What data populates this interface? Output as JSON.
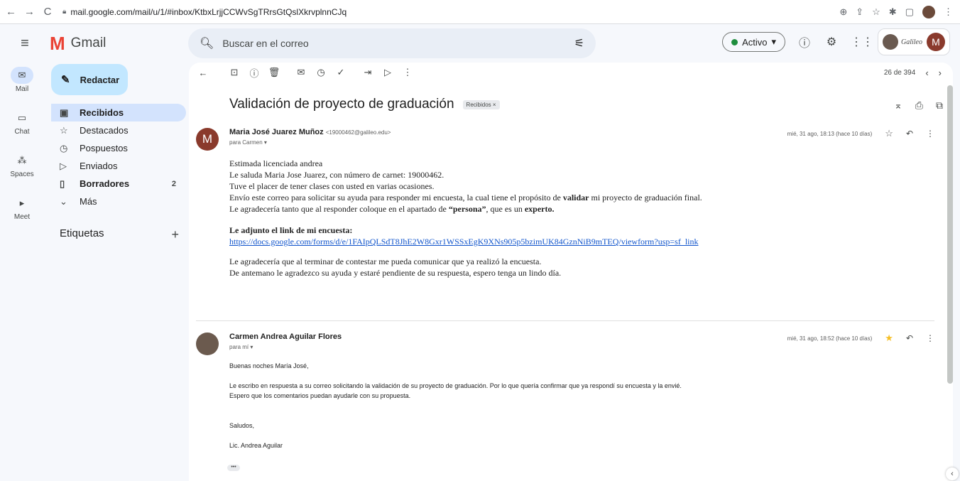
{
  "browser": {
    "url": "mail.google.com/mail/u/1/#inbox/KtbxLrjjCCWvSgTRrsGtQslXkrvplnnCJq",
    "back_icon": "←",
    "forward_icon": "→",
    "reload_icon": "C"
  },
  "header": {
    "app_name": "Gmail",
    "search_placeholder": "Buscar en el correo",
    "status_label": "Activo",
    "org_name": "Galileo",
    "avatar_letter": "M"
  },
  "rail": [
    {
      "label": "Mail",
      "icon": "mail-icon",
      "glyph": "✉"
    },
    {
      "label": "Chat",
      "icon": "chat-icon",
      "glyph": "▭"
    },
    {
      "label": "Spaces",
      "icon": "spaces-icon",
      "glyph": "⁂"
    },
    {
      "label": "Meet",
      "icon": "meet-icon",
      "glyph": "▸"
    }
  ],
  "compose_label": "Redactar",
  "nav": [
    {
      "label": "Recibidos",
      "icon": "inbox-icon",
      "glyph": "▣",
      "count": ""
    },
    {
      "label": "Destacados",
      "icon": "star-icon",
      "glyph": "☆",
      "count": ""
    },
    {
      "label": "Pospuestos",
      "icon": "clock-icon",
      "glyph": "◷",
      "count": ""
    },
    {
      "label": "Enviados",
      "icon": "send-icon",
      "glyph": "▷",
      "count": ""
    },
    {
      "label": "Borradores",
      "icon": "draft-icon",
      "glyph": "▯",
      "count": "2"
    },
    {
      "label": "Más",
      "icon": "chevron-down-icon",
      "glyph": "⌄",
      "count": ""
    }
  ],
  "labels_heading": "Etiquetas",
  "pager": {
    "text": "26 de 394"
  },
  "thread": {
    "subject": "Validación de proyecto de graduación",
    "label_chip": "Recibidos ×"
  },
  "message1": {
    "avatar_letter": "M",
    "sender_name": "Maria José Juarez Muñoz",
    "sender_email": "<19000462@galileo.edu>",
    "to": "para Carmen ▾",
    "date": "mié, 31 ago, 18:13 (hace 10 días)",
    "lines": [
      "Estimada licenciada andrea",
      "Le saluda Maria Jose Juarez, con número de carnet: 19000462.",
      "Tuve el placer de tener clases con usted en varias ocasiones."
    ],
    "line4_a": "Envío este correo para solicitar su ayuda para responder mi encuesta, la cual tiene el propósito de ",
    "line4_b": "validar",
    "line4_c": " mi proyecto de graduación final.",
    "line5_a": "Le agradecería tanto que al responder coloque en el apartado de ",
    "line5_b": "“persona”",
    "line5_c": ", que es un ",
    "line5_d": "experto.",
    "link_heading": "Le adjunto el link de mi encuesta:",
    "link": "https://docs.google.com/forms/d/e/1FAIpQLSdT8JhE2W8Gxr1WSSxEgK9XNs905p5bzimUK84GznNiB9mTEQ/viewform?usp=sf_link",
    "closing": [
      "Le agradecería que al terminar de contestar me pueda comunicar que ya realizó la encuesta.",
      "De antemano le agradezco su ayuda y estaré pendiente de su respuesta, espero tenga un lindo día."
    ]
  },
  "message2": {
    "sender_name": "Carmen Andrea Aguilar Flores",
    "to": "para mí ▾",
    "date": "mié, 31 ago, 18:52 (hace 10 días)",
    "greeting": "Buenas noches María José,",
    "lines": [
      "Le escribo en respuesta a su correo solicitando la validación de su proyecto de graduación. Por lo que quería confirmar que ya respondí su encuesta y la envié.",
      "Espero que los comentarios puedan ayudarle con su propuesta."
    ],
    "sign1": "Saludos,",
    "sign2": "Lic. Andrea Aguilar",
    "more": "•••"
  },
  "colors": {
    "accent": "#0b57d0",
    "nav_active": "#d3e3fd",
    "compose": "#c2e7ff",
    "star_filled": "#f6bf26"
  }
}
